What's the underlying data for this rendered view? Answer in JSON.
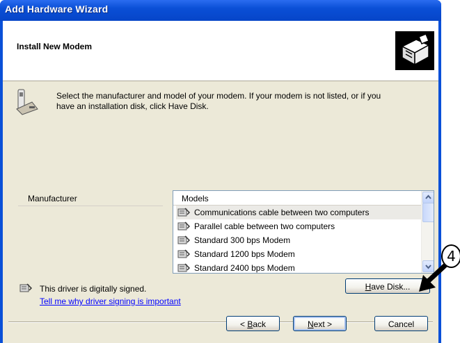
{
  "window": {
    "title": "Add Hardware Wizard"
  },
  "header": {
    "title": "Install New Modem",
    "icon": "hardware-wizard-icon"
  },
  "instruction": {
    "icon": "modem-phone-icon",
    "line1": "Select the manufacturer and model of your modem. If your modem is not listed, or if you",
    "line2": "have an installation disk, click Have Disk."
  },
  "manufacturer": {
    "label": "Manufacturer"
  },
  "models": {
    "header": "Models",
    "items": [
      {
        "label": "Communications cable between two computers",
        "selected": true
      },
      {
        "label": "Parallel cable between two computers",
        "selected": false
      },
      {
        "label": "Standard  300 bps Modem",
        "selected": false
      },
      {
        "label": "Standard  1200 bps Modem",
        "selected": false
      },
      {
        "label": "Standard  2400 bps Modem",
        "selected": false
      }
    ]
  },
  "signing": {
    "status": "This driver is digitally signed.",
    "link": "Tell me why driver signing is important"
  },
  "buttons": {
    "have_disk": {
      "pre": "",
      "mnemonic": "H",
      "post": "ave Disk..."
    },
    "back": {
      "pre": "< ",
      "mnemonic": "B",
      "post": "ack"
    },
    "next": {
      "pre": "",
      "mnemonic": "N",
      "post": "ext >"
    },
    "cancel": "Cancel"
  },
  "annotation": {
    "step": "4"
  },
  "colors": {
    "titlebar": "#0a4fd6",
    "dialog": "#ece9d8",
    "link": "#0000ff"
  }
}
